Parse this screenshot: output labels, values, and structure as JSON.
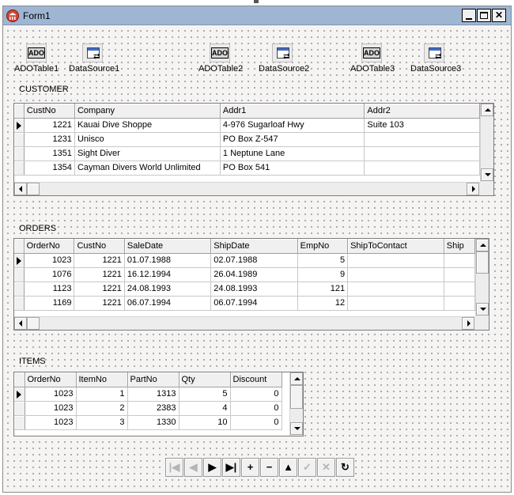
{
  "window": {
    "title": "Form1"
  },
  "components": [
    {
      "name": "ADOTable1",
      "kind": "ado-icon"
    },
    {
      "name": "DataSource1",
      "kind": "datasource-icon"
    },
    {
      "name": "ADOTable2",
      "kind": "ado-icon"
    },
    {
      "name": "DataSource2",
      "kind": "datasource-icon"
    },
    {
      "name": "ADOTable3",
      "kind": "ado-icon"
    },
    {
      "name": "DataSource3",
      "kind": "datasource-icon"
    }
  ],
  "ado_icon_text": "ADO",
  "customer": {
    "label": "CUSTOMER",
    "columns": [
      "CustNo",
      "Company",
      "Addr1",
      "Addr2"
    ],
    "rows": [
      [
        "1221",
        "Kauai Dive Shoppe",
        "4-976 Sugarloaf Hwy",
        "Suite 103"
      ],
      [
        "1231",
        "Unisco",
        "PO Box Z-547",
        ""
      ],
      [
        "1351",
        "Sight Diver",
        "1 Neptune Lane",
        ""
      ],
      [
        "1354",
        "Cayman Divers World Unlimited",
        "PO Box 541",
        ""
      ]
    ]
  },
  "orders": {
    "label": "ORDERS",
    "columns": [
      "OrderNo",
      "CustNo",
      "SaleDate",
      "ShipDate",
      "EmpNo",
      "ShipToContact",
      "Ship"
    ],
    "rows": [
      [
        "1023",
        "1221",
        "01.07.1988",
        "02.07.1988",
        "5",
        "",
        ""
      ],
      [
        "1076",
        "1221",
        "16.12.1994",
        "26.04.1989",
        "9",
        "",
        ""
      ],
      [
        "1123",
        "1221",
        "24.08.1993",
        "24.08.1993",
        "121",
        "",
        ""
      ],
      [
        "1169",
        "1221",
        "06.07.1994",
        "06.07.1994",
        "12",
        "",
        ""
      ]
    ]
  },
  "items": {
    "label": "ITEMS",
    "columns": [
      "OrderNo",
      "ItemNo",
      "PartNo",
      "Qty",
      "Discount"
    ],
    "rows": [
      [
        "1023",
        "1",
        "1313",
        "5",
        "0"
      ],
      [
        "1023",
        "2",
        "2383",
        "4",
        "0"
      ],
      [
        "1023",
        "3",
        "1330",
        "10",
        "0"
      ]
    ]
  },
  "navigator": [
    {
      "action": "first",
      "glyph": "|◀",
      "enabled": false
    },
    {
      "action": "prior",
      "glyph": "◀",
      "enabled": false
    },
    {
      "action": "next",
      "glyph": "▶",
      "enabled": true
    },
    {
      "action": "last",
      "glyph": "▶|",
      "enabled": true
    },
    {
      "action": "insert",
      "glyph": "+",
      "enabled": true
    },
    {
      "action": "delete",
      "glyph": "−",
      "enabled": true
    },
    {
      "action": "edit",
      "glyph": "▲",
      "enabled": true
    },
    {
      "action": "post",
      "glyph": "✓",
      "enabled": false
    },
    {
      "action": "cancel",
      "glyph": "✕",
      "enabled": false
    },
    {
      "action": "refresh",
      "glyph": "↻",
      "enabled": true
    }
  ]
}
